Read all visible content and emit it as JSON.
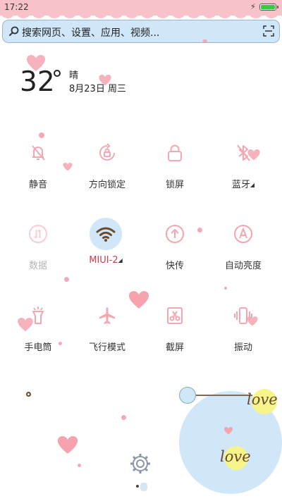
{
  "status": {
    "time": "17:22",
    "battery_level": 1.0,
    "colors": {
      "bar": "#f7c3c9",
      "battery": "#3cc83c"
    }
  },
  "search": {
    "placeholder": "搜索网页、设置、应用、视频...",
    "search_icon": "search-icon",
    "scan_icon": "scan-icon"
  },
  "weather": {
    "temperature": "32",
    "condition": "晴",
    "date": "8月23日 周三"
  },
  "toggles": [
    {
      "label": "静音",
      "icon": "mute-bell-icon",
      "state": "off"
    },
    {
      "label": "方向锁定",
      "icon": "rotation-lock-icon",
      "state": "off"
    },
    {
      "label": "锁屏",
      "icon": "lock-icon",
      "state": "off"
    },
    {
      "label": "蓝牙",
      "icon": "bluetooth-icon",
      "state": "off",
      "expandable": true
    },
    {
      "label": "数据",
      "icon": "mobile-data-icon",
      "state": "disabled"
    },
    {
      "label": "MIUI-2",
      "icon": "wifi-icon",
      "state": "on",
      "expandable": true
    },
    {
      "label": "快传",
      "icon": "quick-share-icon",
      "state": "off"
    },
    {
      "label": "自动亮度",
      "icon": "auto-brightness-icon",
      "state": "off"
    },
    {
      "label": "手电筒",
      "icon": "flashlight-icon",
      "state": "off"
    },
    {
      "label": "飞行模式",
      "icon": "airplane-icon",
      "state": "off"
    },
    {
      "label": "截屏",
      "icon": "screenshot-icon",
      "state": "off"
    },
    {
      "label": "振动",
      "icon": "vibrate-icon",
      "state": "off"
    }
  ],
  "decor": {
    "love_text": "love",
    "settings_icon": "gear-icon",
    "accent_pink": "#f29aa7",
    "accent_blue": "#cfe7f9"
  }
}
